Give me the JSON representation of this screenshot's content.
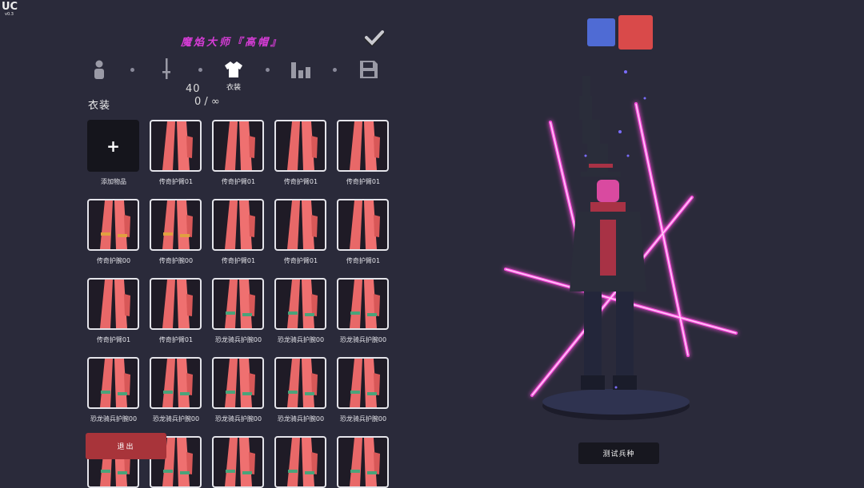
{
  "app": {
    "logo_text": "UC",
    "version": "v0.3"
  },
  "unit": {
    "title": "魔焰大师『高帽』"
  },
  "tabs": [
    {
      "id": "unit",
      "icon": "person-icon"
    },
    {
      "id": "weapon",
      "icon": "sword-icon"
    },
    {
      "id": "clothing",
      "icon": "shirt-icon",
      "label": "衣装",
      "active": true
    },
    {
      "id": "stats",
      "icon": "bar-chart-icon"
    },
    {
      "id": "save",
      "icon": "save-icon"
    }
  ],
  "inventory": {
    "count": "40",
    "capacity": "0 / ∞",
    "section_title": "衣装"
  },
  "items": [
    {
      "label": "添加物品",
      "kind": "add"
    },
    {
      "label": "传奇护臂01"
    },
    {
      "label": "传奇护臂01"
    },
    {
      "label": "传奇护臂01"
    },
    {
      "label": "传奇护臂01"
    },
    {
      "label": "传奇护腕00"
    },
    {
      "label": "传奇护腕00"
    },
    {
      "label": "传奇护臂01"
    },
    {
      "label": "传奇护臂01"
    },
    {
      "label": "传奇护臂01"
    },
    {
      "label": "传奇护臂01"
    },
    {
      "label": "传奇护臂01"
    },
    {
      "label": "恐龙骑兵护腕00"
    },
    {
      "label": "恐龙骑兵护腕00"
    },
    {
      "label": "恐龙骑兵护腕00"
    },
    {
      "label": "恐龙骑兵护腕00"
    },
    {
      "label": "恐龙骑兵护腕00"
    },
    {
      "label": "恐龙骑兵护腕00"
    },
    {
      "label": "恐龙骑兵护腕00"
    },
    {
      "label": "恐龙骑兵护腕00"
    },
    {
      "label": ""
    },
    {
      "label": ""
    },
    {
      "label": ""
    },
    {
      "label": ""
    },
    {
      "label": ""
    }
  ],
  "buttons": {
    "exit": "退出",
    "test_unit": "测试兵种",
    "add_symbol": "+"
  },
  "colors": {
    "team_blue": "#4f6bd4",
    "team_red": "#d94a4a",
    "title": "#d63cd6",
    "exit": "#a8343a"
  }
}
